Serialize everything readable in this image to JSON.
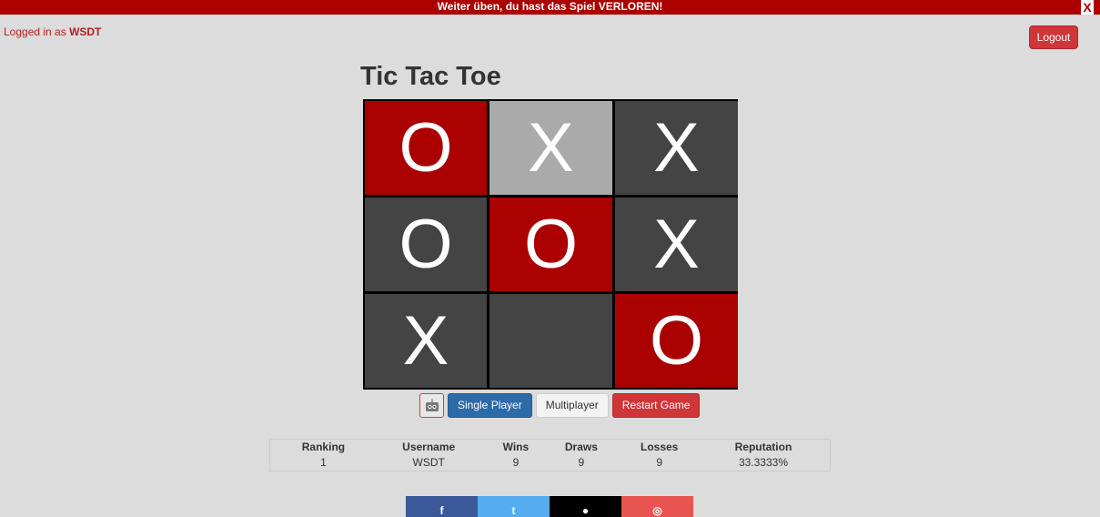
{
  "banner": {
    "message": "Weiter üben, du hast das Spiel VERLOREN!",
    "close_label": "X"
  },
  "login": {
    "prefix": "Logged in as ",
    "username": "WSDT"
  },
  "logout_label": "Logout",
  "title": "Tic Tac Toe",
  "board": [
    {
      "mark": "O",
      "color": "#aa0000"
    },
    {
      "mark": "X",
      "color": "#aaaaaa"
    },
    {
      "mark": "X",
      "color": "#444444"
    },
    {
      "mark": "O",
      "color": "#444444"
    },
    {
      "mark": "O",
      "color": "#aa0000"
    },
    {
      "mark": "X",
      "color": "#444444"
    },
    {
      "mark": "X",
      "color": "#444444"
    },
    {
      "mark": "",
      "color": "#444444"
    },
    {
      "mark": "O",
      "color": "#aa0000"
    }
  ],
  "controls": {
    "single_player": "Single Player",
    "multiplayer": "Multiplayer",
    "restart": "Restart Game"
  },
  "stats": {
    "headers": [
      "Ranking",
      "Username",
      "Wins",
      "Draws",
      "Losses",
      "Reputation"
    ],
    "row": [
      "1",
      "WSDT",
      "9",
      "9",
      "9",
      "33.3333%"
    ]
  },
  "social": [
    {
      "name": "facebook-icon",
      "glyph": "f",
      "color": "#3b5998"
    },
    {
      "name": "twitter-icon",
      "glyph": "t",
      "color": "#55acee"
    },
    {
      "name": "github-icon",
      "glyph": "●",
      "color": "#000000"
    },
    {
      "name": "instagram-icon",
      "glyph": "◎",
      "color": "#e85450"
    }
  ]
}
